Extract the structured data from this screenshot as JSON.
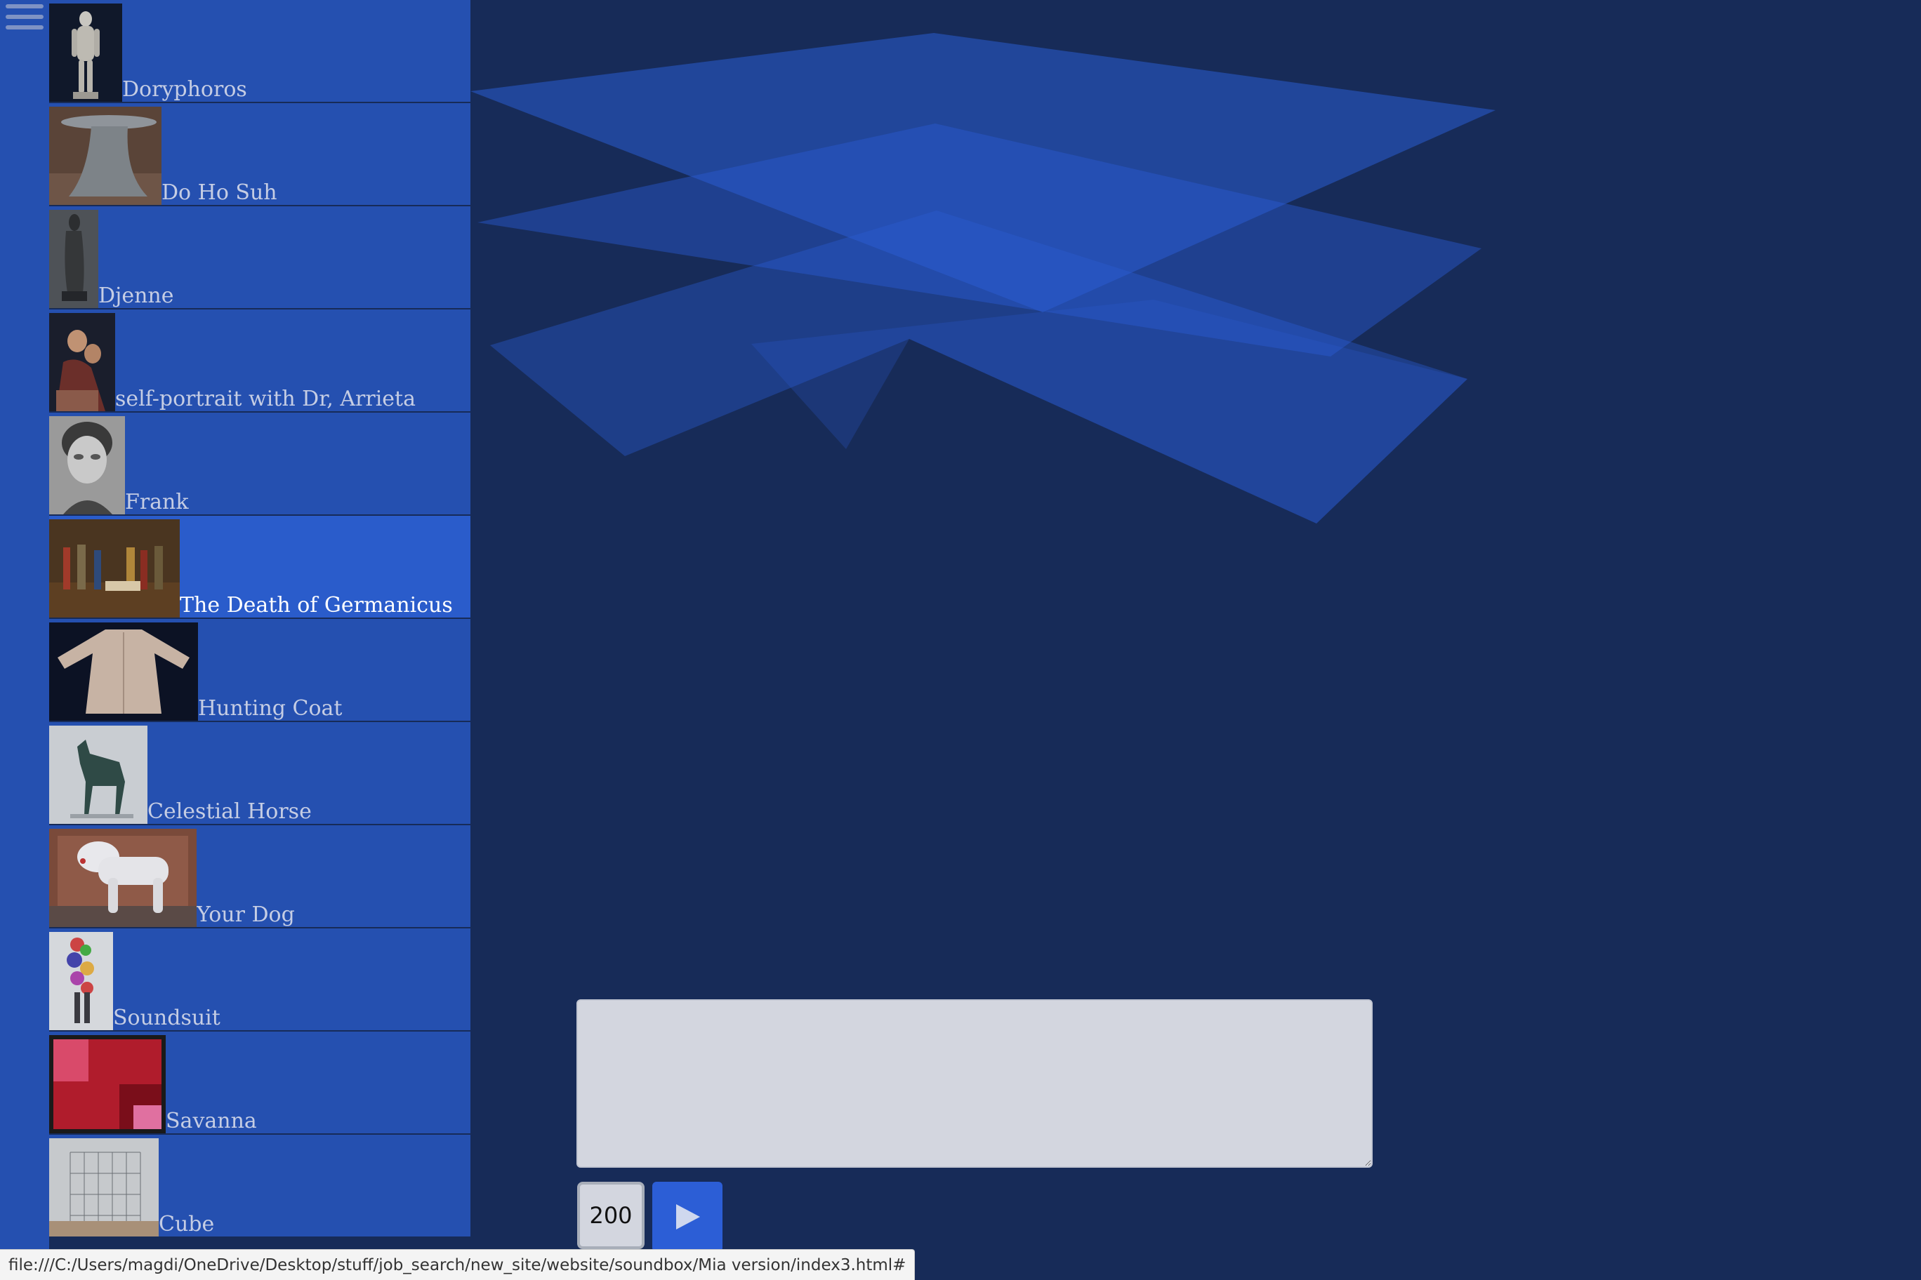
{
  "menu": {
    "icon": "hamburger-menu-icon"
  },
  "artworks": [
    {
      "title": "Doryphoros"
    },
    {
      "title": "Do Ho Suh"
    },
    {
      "title": "Djenne"
    },
    {
      "title": "self-portrait with Dr, Arrieta"
    },
    {
      "title": "Frank"
    },
    {
      "title": "The Death of Germanicus",
      "active": true
    },
    {
      "title": "Hunting Coat"
    },
    {
      "title": "Celestial Horse"
    },
    {
      "title": "Your Dog"
    },
    {
      "title": "Soundsuit"
    },
    {
      "title": "Savanna"
    },
    {
      "title": "Cube"
    }
  ],
  "composer": {
    "text": "",
    "count": "200",
    "play_icon": "play-icon"
  },
  "status_bar": {
    "url": "file:///C:/Users/magdi/OneDrive/Desktop/stuff/job_search/new_site/website/soundbox/Mia version/index3.html#"
  },
  "colors": {
    "background": "#172b58",
    "panel": "#2550b0",
    "panel_active": "#2a5ccb",
    "accent": "#2c5ed6",
    "plane": "#2a5cd2"
  }
}
